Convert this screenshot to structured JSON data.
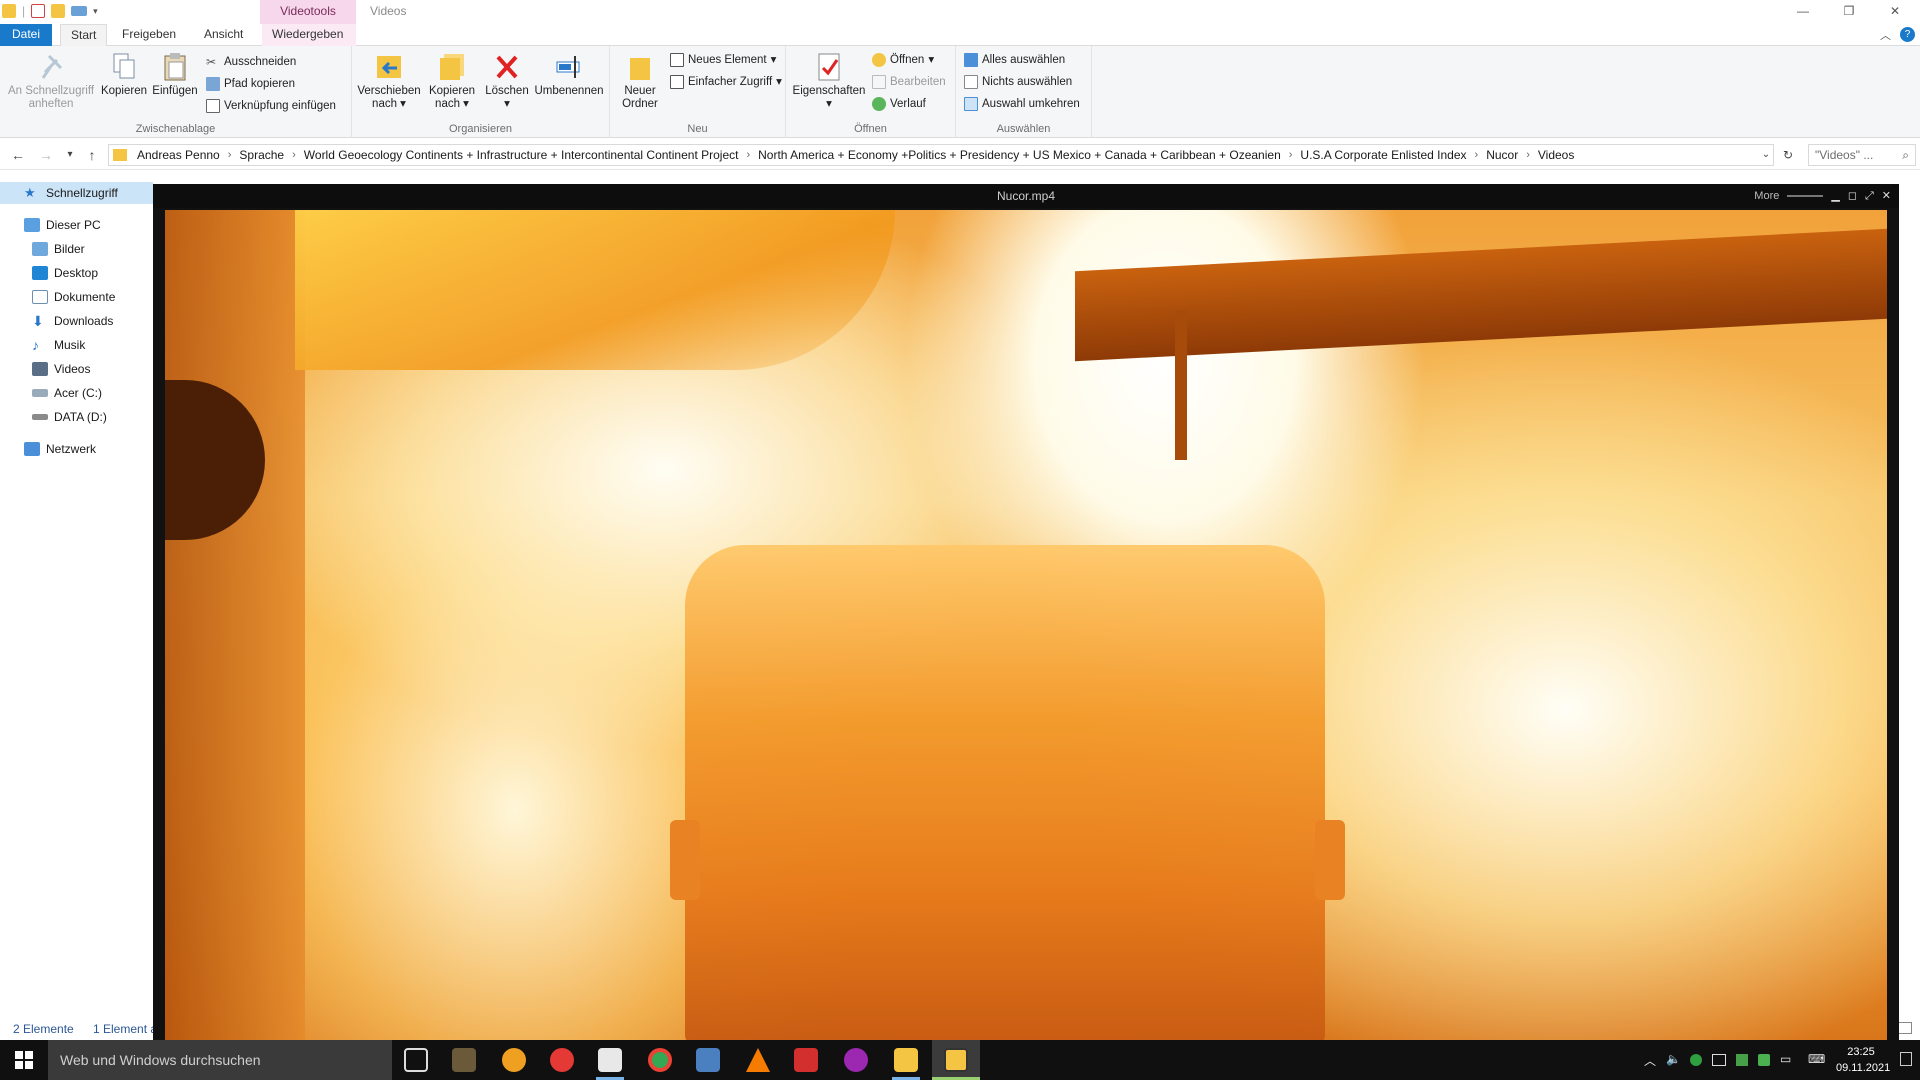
{
  "window": {
    "title": "Videos",
    "context_tab_header": "Videotools"
  },
  "ribbon_tabs": [
    "Datei",
    "Start",
    "Freigeben",
    "Ansicht",
    "Wiedergeben"
  ],
  "ribbon": {
    "zwischenablage": {
      "label": "Zwischenablage",
      "pin": "An Schnellzugriff anheften",
      "copy": "Kopieren",
      "paste": "Einfügen",
      "cut": "Ausschneiden",
      "copy_path": "Pfad kopieren",
      "paste_shortcut": "Verknüpfung einfügen"
    },
    "organisieren": {
      "label": "Organisieren",
      "move": "Verschieben nach",
      "copy_to": "Kopieren nach",
      "delete": "Löschen",
      "rename": "Umbenennen"
    },
    "neu": {
      "label": "Neu",
      "new_folder": "Neuer Ordner",
      "new_item": "Neues Element",
      "easy_access": "Einfacher Zugriff"
    },
    "oeffnen": {
      "label": "Öffnen",
      "properties": "Eigenschaften",
      "open": "Öffnen",
      "edit": "Bearbeiten",
      "history": "Verlauf"
    },
    "auswaehlen": {
      "label": "Auswählen",
      "select_all": "Alles auswählen",
      "select_none": "Nichts auswählen",
      "invert": "Auswahl umkehren"
    }
  },
  "address": {
    "crumbs": [
      "Andreas Penno",
      "Sprache",
      "World Geoecology Continents + Infrastructure + Intercontinental Continent Project",
      "North America + Economy +Politics + Presidency + US  Mexico + Canada + Caribbean + Ozeanien",
      "U.S.A Corporate Enlisted Index",
      "Nucor",
      "Videos"
    ],
    "search_placeholder": "\"Videos\" ..."
  },
  "nav": {
    "quick_access": "Schnellzugriff",
    "this_pc": "Dieser PC",
    "items": [
      "Bilder",
      "Desktop",
      "Dokumente",
      "Downloads",
      "Musik",
      "Videos",
      "Acer (C:)",
      "DATA (D:)"
    ],
    "network": "Netzwerk"
  },
  "status": {
    "count": "2 Elemente",
    "selected": "1 Element a"
  },
  "player": {
    "title": "Nucor.mp4",
    "more": "More"
  },
  "taskbar": {
    "search_placeholder": "Web und Windows durchsuchen",
    "time": "23:25",
    "date": "09.11.2021"
  },
  "colors": {
    "accent": "#1979ca",
    "context_tab": "#f7d7ec",
    "selection": "#cce4f7",
    "taskbar": "#101010"
  }
}
